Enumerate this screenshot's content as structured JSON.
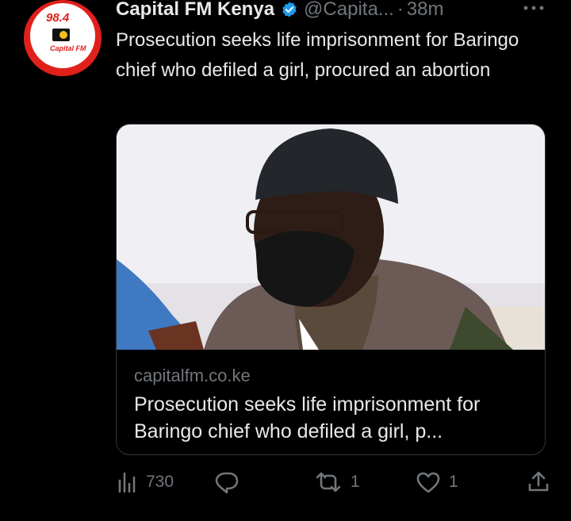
{
  "account": {
    "avatar_text_top": "98.4",
    "avatar_text_bottom": "Capital FM",
    "name": "Capital FM Kenya",
    "verified": true,
    "handle": "@Capita...",
    "separator": "·",
    "time": "38m"
  },
  "tweet": {
    "text": "Prosecution seeks life imprisonment for Baringo chief who defiled a girl, procured an abortion"
  },
  "card": {
    "image_icon": "photo-of-masked-man-in-court",
    "domain": "capitalfm.co.ke",
    "title": "Prosecution seeks life imprisonment for Baringo chief who defiled a girl, p..."
  },
  "actions": {
    "views": "730",
    "replies": "",
    "retweets": "1",
    "likes": "1",
    "share": ""
  },
  "colors": {
    "background": "#000000",
    "text": "#e7e9ea",
    "muted": "#71767b",
    "verified": "#1d9bf0",
    "brand_red": "#e0201b"
  }
}
